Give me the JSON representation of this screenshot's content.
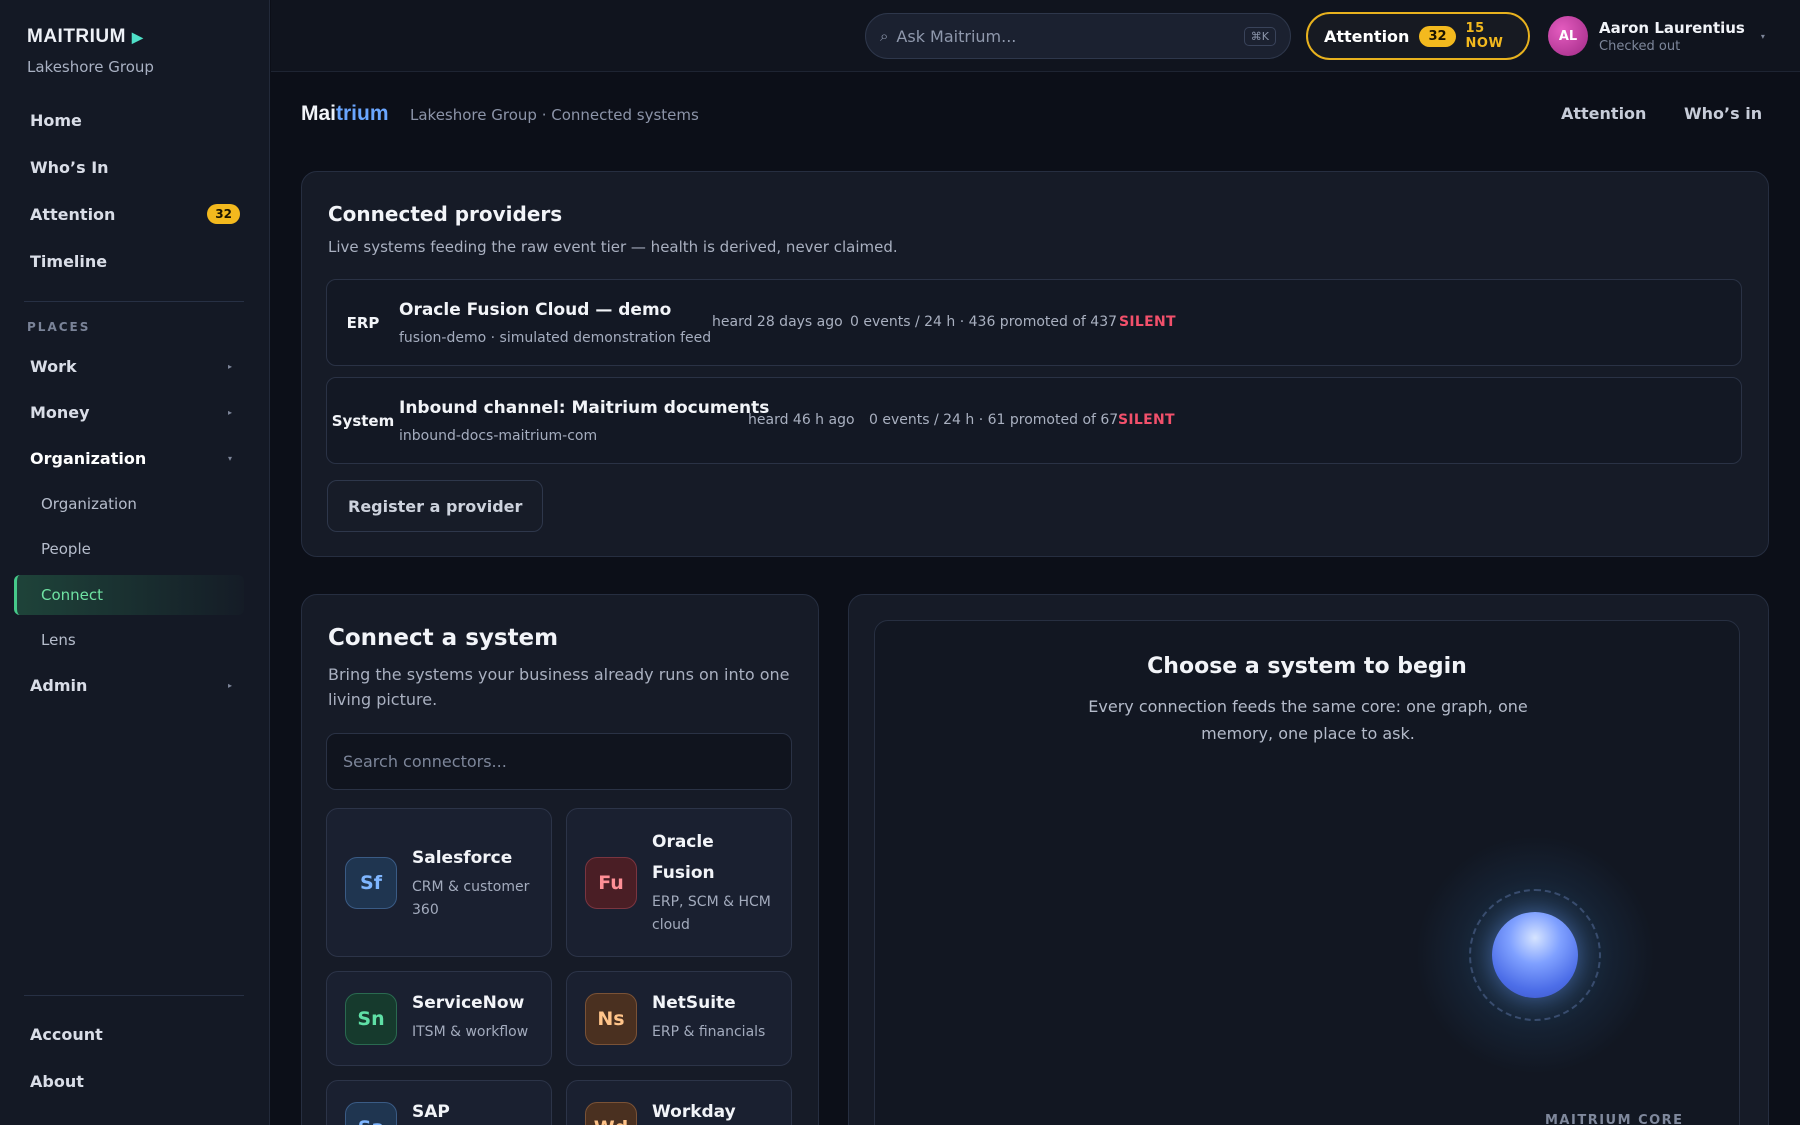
{
  "brand": {
    "name": "MAITRIUM",
    "org": "Lakeshore Group"
  },
  "nav": {
    "home": "Home",
    "whos_in": "Who’s In",
    "attention": "Attention",
    "attention_count": "32",
    "timeline": "Timeline",
    "places_label": "PLACES",
    "work": "Work",
    "money": "Money",
    "organization": "Organization",
    "sub_organization": "Organization",
    "people": "People",
    "connect": "Connect",
    "lens": "Lens",
    "admin": "Admin",
    "account": "Account",
    "about": "About"
  },
  "topbar": {
    "search_placeholder": "Ask Maitrium...",
    "shortcut": "⌘K",
    "attention_label": "Attention",
    "attention_count": "32",
    "attention_now": "15 NOW",
    "user_initials": "AL",
    "user_name": "Aaron Laurentius",
    "user_status": "Checked out"
  },
  "header": {
    "logo_a": "Mai",
    "logo_b": "trium",
    "crumb": "Lakeshore Group · Connected systems",
    "link_attention": "Attention",
    "link_whos_in": "Who’s in"
  },
  "providers": {
    "title": "Connected providers",
    "subtitle": "Live systems feeding the raw event tier — health is derived, never claimed.",
    "items": [
      {
        "tag": "ERP",
        "name": "Oracle Fusion Cloud — demo",
        "id": "fusion-demo · simulated demonstration feed",
        "heard": "heard 28 days ago",
        "events": "0 events / 24 h · 436 promoted of 437",
        "status": "SILENT"
      },
      {
        "tag": "System",
        "name": "Inbound channel: Maitrium documents",
        "id": "inbound-docs-maitrium-com",
        "heard": "heard 46 h ago",
        "events": "0 events / 24 h · 61 promoted of 67",
        "status": "SILENT"
      }
    ],
    "register_label": "Register a provider"
  },
  "connect": {
    "title": "Connect a system",
    "subtitle": "Bring the systems your business already runs on into one living picture.",
    "search_placeholder": "Search connectors...",
    "connectors": [
      {
        "abbr": "Sf",
        "name": "Salesforce",
        "desc": "CRM & customer 360"
      },
      {
        "abbr": "Fu",
        "name": "Oracle Fusion",
        "desc": "ERP, SCM & HCM cloud"
      },
      {
        "abbr": "Sn",
        "name": "ServiceNow",
        "desc": "ITSM & workflow"
      },
      {
        "abbr": "Ns",
        "name": "NetSuite",
        "desc": "ERP & financials"
      },
      {
        "abbr": "Sa",
        "name": "SAP",
        "desc": ""
      },
      {
        "abbr": "Wd",
        "name": "Workday",
        "desc": ""
      }
    ]
  },
  "core": {
    "title": "Choose a system to begin",
    "subtitle": "Every connection feeds the same core: one graph, one memory, one place to ask.",
    "label": "MAITRIUM CORE"
  },
  "colors": {
    "accent_green": "#46c98a",
    "attention_yellow": "#f3b91e",
    "silent_red": "#f2506b",
    "brand_blue": "#6aa6ff"
  }
}
